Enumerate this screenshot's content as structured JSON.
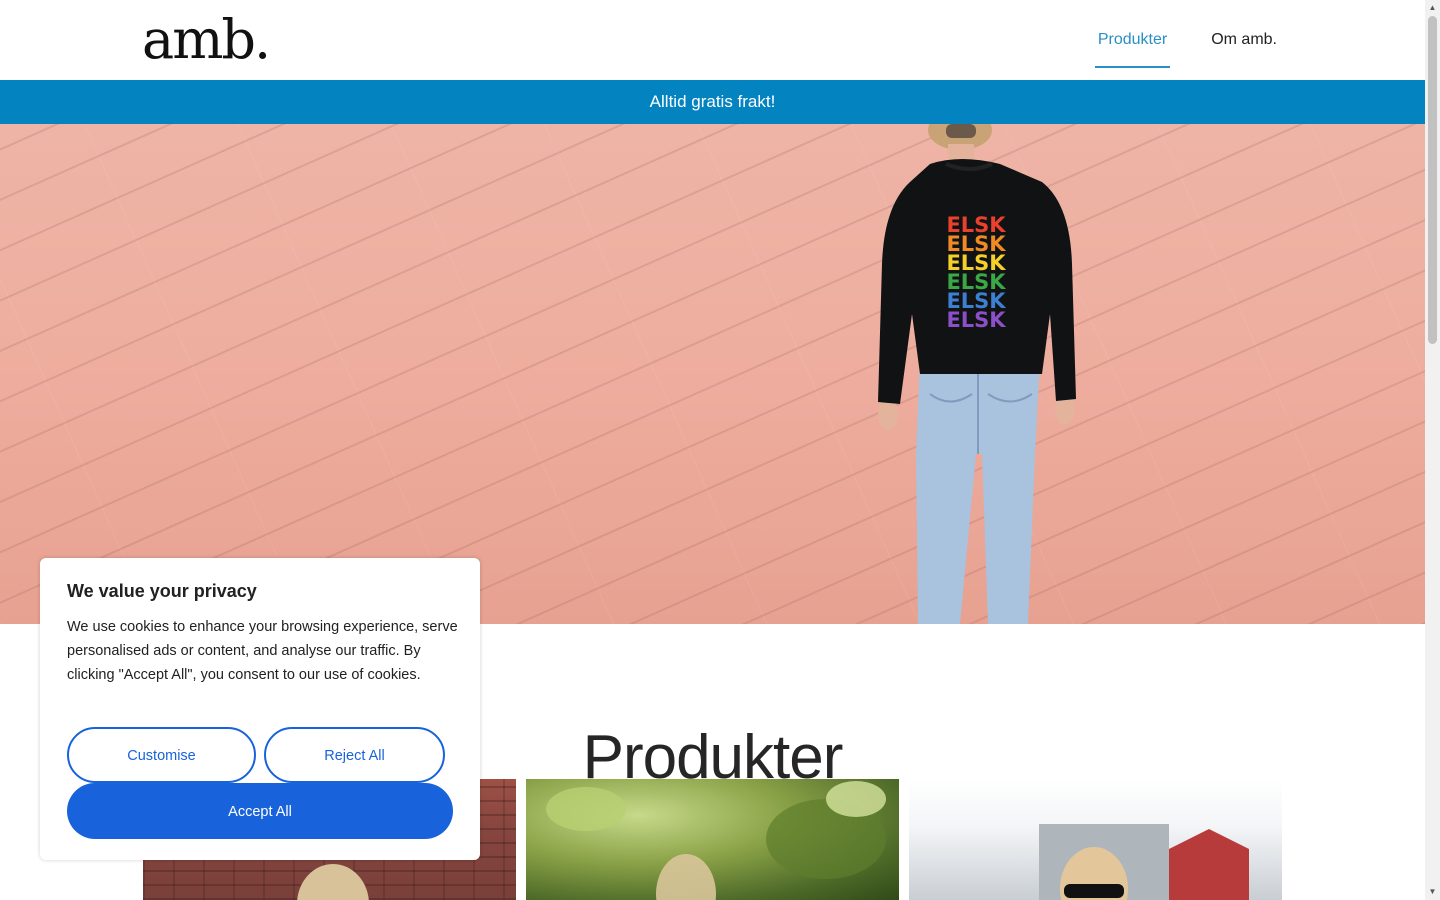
{
  "header": {
    "logo": "amb.",
    "nav": [
      {
        "label": "Produkter",
        "active": true
      },
      {
        "label": "Om amb.",
        "active": false
      }
    ]
  },
  "banner": {
    "text": "Alltid gratis frakt!"
  },
  "hero": {
    "sweater_print": [
      "ELSK",
      "ELSK",
      "ELSK",
      "ELSK",
      "ELSK",
      "ELSK"
    ]
  },
  "products": {
    "title": "Produkter"
  },
  "cookie_banner": {
    "title": "We value your privacy",
    "body": "We use cookies to enhance your browsing experience, serve personalised ads or content, and analyse our traffic. By clicking \"Accept All\", you consent to our use of cookies.",
    "customise_label": "Customise",
    "reject_label": "Reject All",
    "accept_label": "Accept All"
  },
  "colors": {
    "accent": "#2a8fc4",
    "banner": "#0383c0",
    "cookie_button": "#1863dc"
  }
}
